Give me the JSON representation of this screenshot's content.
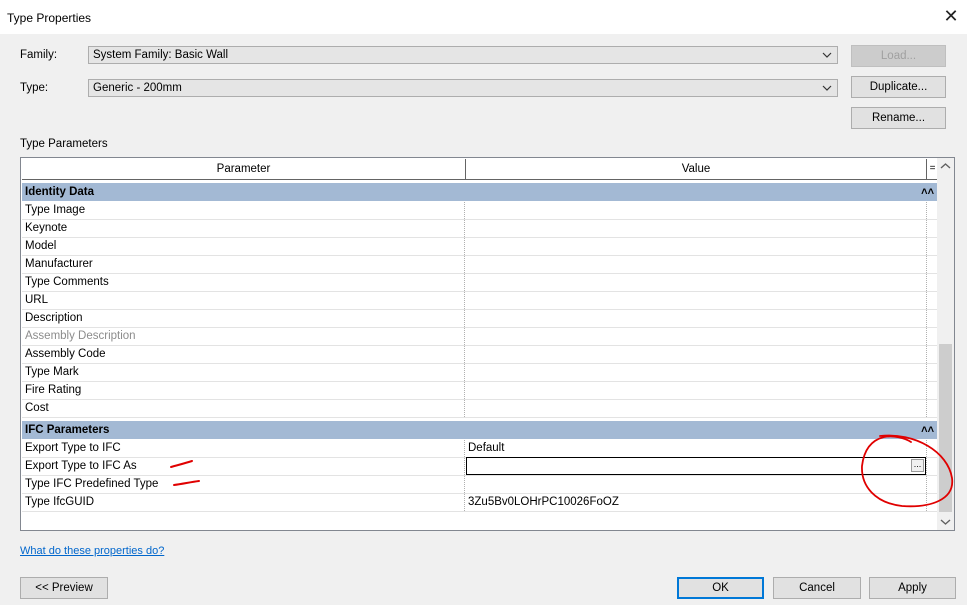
{
  "window": {
    "title": "Type Properties",
    "close_glyph": "✕"
  },
  "family": {
    "label": "Family:",
    "value": "System Family: Basic Wall"
  },
  "type": {
    "label": "Type:",
    "value": "Generic - 200mm"
  },
  "buttons": {
    "load": "Load...",
    "duplicate": "Duplicate...",
    "rename": "Rename...",
    "preview": "<< Preview",
    "ok": "OK",
    "cancel": "Cancel",
    "apply": "Apply"
  },
  "section_label": "Type Parameters",
  "table": {
    "header_parameter": "Parameter",
    "header_value": "Value",
    "header_toggle": "=",
    "groups": [
      {
        "name": "Identity Data",
        "collapse_glyph": "˄˄",
        "rows": [
          {
            "name": "Type Image",
            "value": ""
          },
          {
            "name": "Keynote",
            "value": ""
          },
          {
            "name": "Model",
            "value": ""
          },
          {
            "name": "Manufacturer",
            "value": ""
          },
          {
            "name": "Type Comments",
            "value": ""
          },
          {
            "name": "URL",
            "value": ""
          },
          {
            "name": "Description",
            "value": ""
          },
          {
            "name": "Assembly Description",
            "value": ""
          },
          {
            "name": "Assembly Code",
            "value": ""
          },
          {
            "name": "Type Mark",
            "value": ""
          },
          {
            "name": "Fire Rating",
            "value": ""
          },
          {
            "name": "Cost",
            "value": ""
          }
        ]
      },
      {
        "name": "IFC Parameters",
        "collapse_glyph": "˄˄",
        "rows": [
          {
            "name": "Export Type to IFC",
            "value": "Default"
          },
          {
            "name": "Export Type to IFC As",
            "value": ""
          },
          {
            "name": "Type IFC Predefined Type",
            "value": ""
          },
          {
            "name": "Type IfcGUID",
            "value": "3Zu5Bv0LOHrPC10026FoOZ"
          }
        ]
      }
    ],
    "edit_button_glyph": "..."
  },
  "help_link": "What do these properties do?",
  "colors": {
    "group_header": "#a3b9d4",
    "accent": "#0078d7",
    "link": "#0066cc",
    "annotation": "#e00000"
  }
}
